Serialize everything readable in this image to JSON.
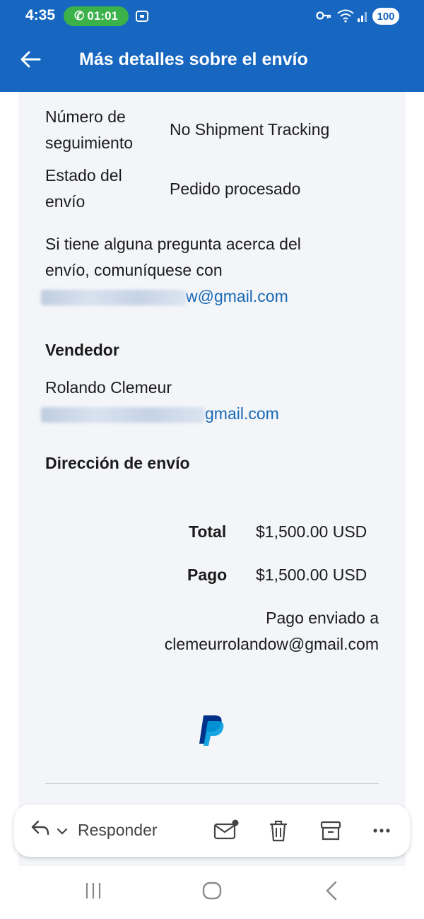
{
  "status_bar": {
    "time": "4:35",
    "call_timer": "01:01",
    "battery": "100"
  },
  "header": {
    "title": "Más detalles sobre el envío"
  },
  "shipment": {
    "tracking_label_1": "Número de",
    "tracking_label_2": "seguimiento",
    "tracking_value": "No Shipment Tracking",
    "status_label_1": "Estado del",
    "status_label_2": "envío",
    "status_value": "Pedido procesado",
    "question_line_1": "Si tiene alguna pregunta acerca del",
    "question_line_2": "envío, comuníquese con",
    "contact_email_visible": "w@gmail.com"
  },
  "seller": {
    "heading": "Vendedor",
    "name": "Rolando Clemeur",
    "email_visible": "gmail.com"
  },
  "shipping_address": {
    "heading": "Dirección de envío"
  },
  "totals": {
    "total_label": "Total",
    "total_value": "$1,500.00 USD",
    "payment_label": "Pago",
    "payment_value": "$1,500.00 USD",
    "sent_to_label": "Pago enviado a",
    "sent_to_email": "clemeurrolandow@gmail.com"
  },
  "action_bar": {
    "reply_label": "Responder"
  },
  "colors": {
    "header_blue": "#1767c0",
    "link_blue": "#1868b5",
    "call_green": "#3bb14a",
    "card_bg": "#f3f5f8",
    "paypal_dark": "#003087",
    "paypal_light": "#009cde"
  },
  "icons": [
    "back-arrow-icon",
    "phone-icon",
    "screen-record-icon",
    "key-icon",
    "wifi-icon",
    "signal-icon",
    "reply-icon",
    "chevron-down-icon",
    "mail-unread-icon",
    "trash-icon",
    "archive-icon",
    "more-icon",
    "recent-apps-icon",
    "home-icon",
    "nav-back-icon",
    "paypal-logo"
  ]
}
